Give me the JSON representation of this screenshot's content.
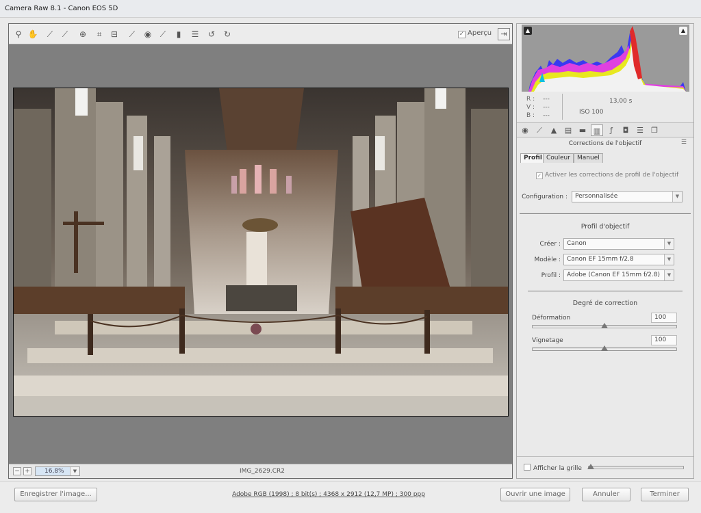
{
  "window": {
    "title": "Camera Raw 8.1  -  Canon EOS 5D"
  },
  "toolbar": {
    "tools": [
      "zoom-icon",
      "hand-icon",
      "white-balance-icon",
      "color-sampler-icon",
      "targeted-adjustment-icon",
      "crop-icon",
      "straighten-icon",
      "spot-removal-icon",
      "red-eye-icon",
      "adjustment-brush-icon",
      "graduated-filter-icon",
      "preferences-icon",
      "rotate-left-icon",
      "rotate-right-icon"
    ],
    "preview_label": "Aperçu",
    "preview_checked": "✓"
  },
  "status": {
    "zoom": "16,8%",
    "filename": "IMG_2629.CR2"
  },
  "readout": {
    "r_label": "R :",
    "g_label": "V :",
    "b_label": "B :",
    "r": "---",
    "g": "---",
    "b": "---",
    "shutter": "13,00 s",
    "iso": "ISO 100"
  },
  "panel": {
    "tabs": [
      "aperture-icon",
      "tone-curve-icon",
      "detail-icon",
      "hsl-icon",
      "split-toning-icon",
      "lens-corrections-icon",
      "effects-icon",
      "camera-calibration-icon",
      "presets-icon",
      "snapshots-icon"
    ],
    "title": "Corrections de l'objectif",
    "subtabs": {
      "profil": "Profil",
      "couleur": "Couleur",
      "manuel": "Manuel"
    },
    "enable_label": "Activer les corrections de profil de l'objectif",
    "enable_checked": "✓",
    "configuration_label": "Configuration :",
    "configuration_value": "Personnalisée",
    "profile_section": "Profil d'objectif",
    "maker_label": "Créer :",
    "maker_value": "Canon",
    "model_label": "Modèle :",
    "model_value": "Canon EF 15mm f/2.8",
    "profile_label": "Profil :",
    "profile_value": "Adobe (Canon EF 15mm f/2.8)",
    "degree_section": "Degré de correction",
    "distortion_label": "Déformation",
    "distortion_value": "100",
    "vignetting_label": "Vignetage",
    "vignetting_value": "100",
    "grid_label": "Afficher la grille"
  },
  "footer": {
    "save_label": "Enregistrer l'image...",
    "workflow": "Adobe RGB (1998) ; 8 bit(s) ; 4368 x 2912 (12,7 MP) ; 300 ppp",
    "open_label": "Ouvrir une image",
    "cancel_label": "Annuler",
    "done_label": "Terminer"
  }
}
